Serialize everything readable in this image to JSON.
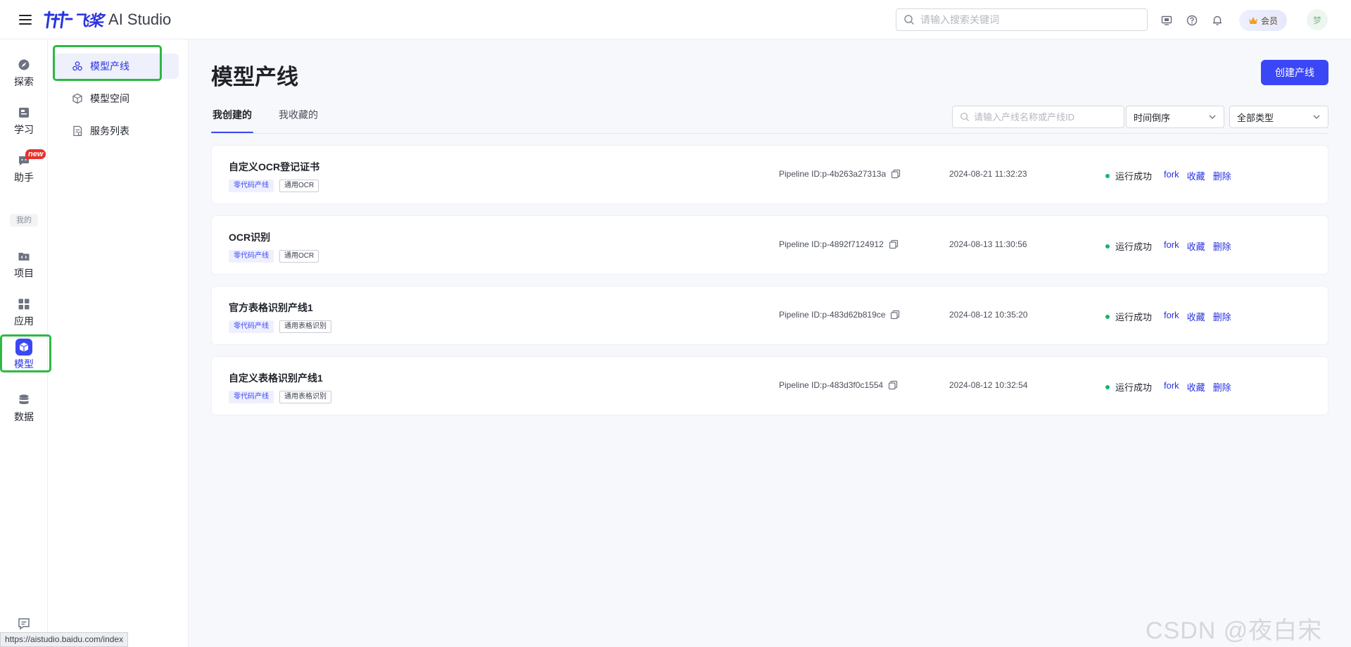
{
  "header": {
    "brand_cn": "飞桨",
    "brand_en": "AI Studio",
    "search_placeholder": "请输入搜索关键词",
    "vip_label": "会员",
    "avatar_text": "梦"
  },
  "rail": {
    "items": [
      {
        "label": "探索",
        "icon": "compass-icon"
      },
      {
        "label": "学习",
        "icon": "book-icon"
      },
      {
        "label": "助手",
        "icon": "chat-icon",
        "badge": "new"
      },
      {
        "label": "项目",
        "icon": "folder-code-icon"
      },
      {
        "label": "应用",
        "icon": "apps-icon"
      },
      {
        "label": "模型",
        "icon": "cube-icon",
        "active": true
      },
      {
        "label": "数据",
        "icon": "database-icon"
      }
    ],
    "mine_label": "我的"
  },
  "subnav": {
    "items": [
      {
        "label": "模型产线",
        "active": true
      },
      {
        "label": "模型空间"
      },
      {
        "label": "服务列表"
      }
    ]
  },
  "main": {
    "title": "模型产线",
    "create_button": "创建产线",
    "tabs": [
      {
        "label": "我创建的",
        "active": true
      },
      {
        "label": "我收藏的"
      }
    ],
    "filter_placeholder": "请输入产线名称或产线ID",
    "sort_select": "时间倒序",
    "type_select": "全部类型"
  },
  "pipelines": [
    {
      "name": "自定义OCR登记证书",
      "tags": [
        "零代码产线",
        "通用OCR"
      ],
      "pipeline_id": "Pipeline ID:p-4b263a27313a",
      "time": "2024-08-21 11:32:23",
      "status": "运行成功"
    },
    {
      "name": "OCR识别",
      "tags": [
        "零代码产线",
        "通用OCR"
      ],
      "pipeline_id": "Pipeline ID:p-4892f7124912",
      "time": "2024-08-13 11:30:56",
      "status": "运行成功"
    },
    {
      "name": "官方表格识别产线1",
      "tags": [
        "零代码产线",
        "通用表格识别"
      ],
      "pipeline_id": "Pipeline ID:p-483d62b819ce",
      "time": "2024-08-12 10:35:20",
      "status": "运行成功"
    },
    {
      "name": "自定义表格识别产线1",
      "tags": [
        "零代码产线",
        "通用表格识别"
      ],
      "pipeline_id": "Pipeline ID:p-483d3f0c1554",
      "time": "2024-08-12 10:32:54",
      "status": "运行成功"
    }
  ],
  "row_actions": [
    "fork",
    "收藏",
    "删除"
  ],
  "statusbar_url": "https://aistudio.baidu.com/index",
  "watermark": "CSDN @夜白宋",
  "colors": {
    "primary": "#3b47f5",
    "success": "#13b66b",
    "highlight_box": "#2fb845"
  }
}
